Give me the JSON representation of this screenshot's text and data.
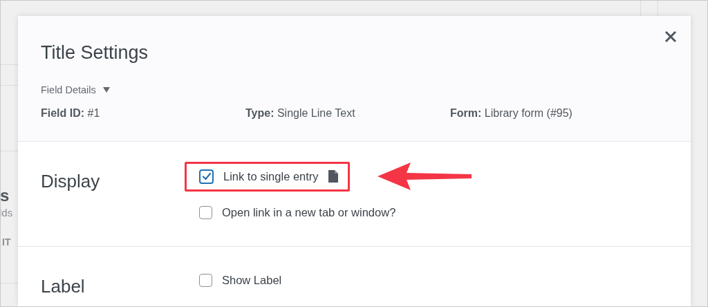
{
  "background_page": {
    "heading": "s",
    "subtext": "lds",
    "column_header": "IT"
  },
  "dialog": {
    "title": "Title Settings",
    "details_toggle": {
      "label": "Field Details",
      "expanded": true
    },
    "details": [
      {
        "label": "Field ID:",
        "value": "#1"
      },
      {
        "label": "Type:",
        "value": "Single Line Text"
      },
      {
        "label": "Form:",
        "value": "Library form (#95)"
      }
    ],
    "sections": [
      {
        "heading": "Display",
        "options": [
          {
            "label": "Link to single entry",
            "checked": true,
            "has_doc_icon": true,
            "highlighted": true
          },
          {
            "label": "Open link in a new tab or window?",
            "checked": false,
            "has_doc_icon": false,
            "highlighted": false
          }
        ]
      },
      {
        "heading": "Label",
        "options": [
          {
            "label": "Show Label",
            "checked": false,
            "has_doc_icon": false,
            "highlighted": false
          }
        ]
      }
    ]
  }
}
